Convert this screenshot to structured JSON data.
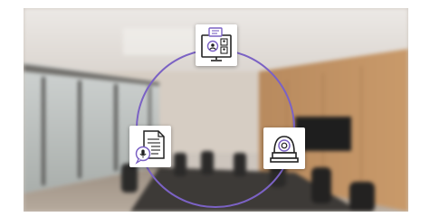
{
  "scene": {
    "background": "blurred-conference-room-photo",
    "accent_color": "#7b62c4",
    "ring_color": "#7b62c4"
  },
  "icons": [
    {
      "name": "video-conference-icon",
      "position_word": "top"
    },
    {
      "name": "document-with-microphone-icon",
      "position_word": "bottom-left"
    },
    {
      "name": "ptz-camera-icon",
      "position_word": "bottom-right"
    }
  ]
}
